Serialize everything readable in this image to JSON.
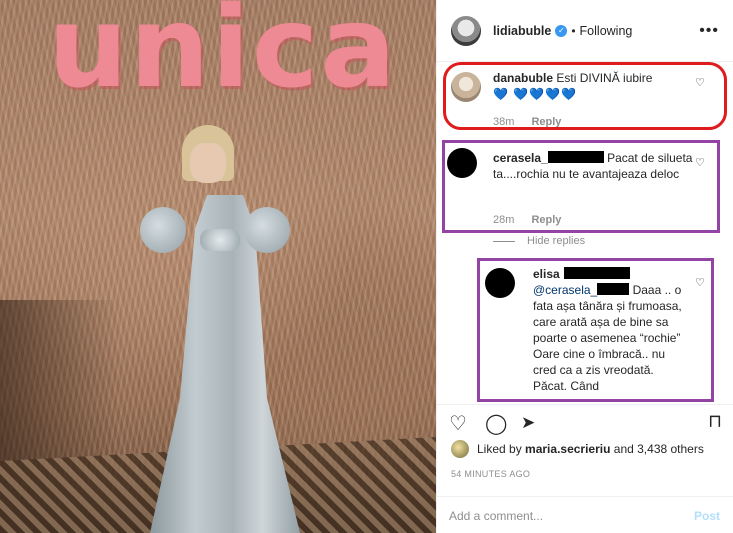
{
  "photo": {
    "sign_text": "unica"
  },
  "header": {
    "username": "lidiabuble",
    "verified_icon": "verified-badge-icon",
    "separator": "•",
    "following_label": "Following",
    "more_label": "•••"
  },
  "comments": [
    {
      "user": "danabuble",
      "text": "Esti DIVINĂ iubire",
      "emoji": "💙 💙💙💙💙",
      "time": "38m",
      "reply": "Reply"
    },
    {
      "user": "cerasela_",
      "text": "Pacat de silueta ta....rochia nu te avantajeaza deloc",
      "time": "28m",
      "reply": "Reply"
    },
    {
      "hide_replies": "Hide replies"
    },
    {
      "user": "elisa",
      "mention": "@cerasela_",
      "text": "Daaa .. o fata așa tânăra și frumoasa, care arată așa de bine sa poarte o asemenea “rochie” Oare cine o îmbracă.. nu cred ca a zis vreodată. Păcat. Când"
    }
  ],
  "likes": {
    "prefix": "Liked by",
    "user": "maria.secrieriu",
    "suffix": "and 3,438 others"
  },
  "timestamp": "54 MINUTES AGO",
  "add_comment": {
    "placeholder": "Add a comment...",
    "post_label": "Post"
  },
  "colors": {
    "annotation_red": "#e01b1b",
    "annotation_purple": "#9343a3",
    "link_blue": "#3897f0",
    "heart_blue": "#1da5e5"
  }
}
